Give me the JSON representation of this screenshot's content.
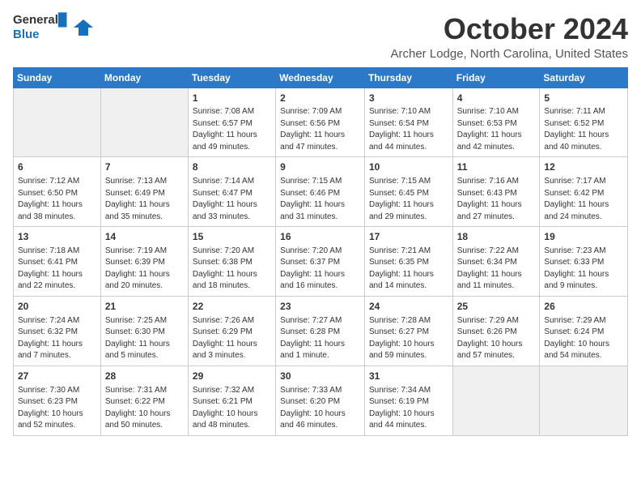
{
  "logo": {
    "line1": "General",
    "line2": "Blue"
  },
  "title": "October 2024",
  "location": "Archer Lodge, North Carolina, United States",
  "weekdays": [
    "Sunday",
    "Monday",
    "Tuesday",
    "Wednesday",
    "Thursday",
    "Friday",
    "Saturday"
  ],
  "weeks": [
    [
      {
        "day": "",
        "info": ""
      },
      {
        "day": "",
        "info": ""
      },
      {
        "day": "1",
        "info": "Sunrise: 7:08 AM\nSunset: 6:57 PM\nDaylight: 11 hours\nand 49 minutes."
      },
      {
        "day": "2",
        "info": "Sunrise: 7:09 AM\nSunset: 6:56 PM\nDaylight: 11 hours\nand 47 minutes."
      },
      {
        "day": "3",
        "info": "Sunrise: 7:10 AM\nSunset: 6:54 PM\nDaylight: 11 hours\nand 44 minutes."
      },
      {
        "day": "4",
        "info": "Sunrise: 7:10 AM\nSunset: 6:53 PM\nDaylight: 11 hours\nand 42 minutes."
      },
      {
        "day": "5",
        "info": "Sunrise: 7:11 AM\nSunset: 6:52 PM\nDaylight: 11 hours\nand 40 minutes."
      }
    ],
    [
      {
        "day": "6",
        "info": "Sunrise: 7:12 AM\nSunset: 6:50 PM\nDaylight: 11 hours\nand 38 minutes."
      },
      {
        "day": "7",
        "info": "Sunrise: 7:13 AM\nSunset: 6:49 PM\nDaylight: 11 hours\nand 35 minutes."
      },
      {
        "day": "8",
        "info": "Sunrise: 7:14 AM\nSunset: 6:47 PM\nDaylight: 11 hours\nand 33 minutes."
      },
      {
        "day": "9",
        "info": "Sunrise: 7:15 AM\nSunset: 6:46 PM\nDaylight: 11 hours\nand 31 minutes."
      },
      {
        "day": "10",
        "info": "Sunrise: 7:15 AM\nSunset: 6:45 PM\nDaylight: 11 hours\nand 29 minutes."
      },
      {
        "day": "11",
        "info": "Sunrise: 7:16 AM\nSunset: 6:43 PM\nDaylight: 11 hours\nand 27 minutes."
      },
      {
        "day": "12",
        "info": "Sunrise: 7:17 AM\nSunset: 6:42 PM\nDaylight: 11 hours\nand 24 minutes."
      }
    ],
    [
      {
        "day": "13",
        "info": "Sunrise: 7:18 AM\nSunset: 6:41 PM\nDaylight: 11 hours\nand 22 minutes."
      },
      {
        "day": "14",
        "info": "Sunrise: 7:19 AM\nSunset: 6:39 PM\nDaylight: 11 hours\nand 20 minutes."
      },
      {
        "day": "15",
        "info": "Sunrise: 7:20 AM\nSunset: 6:38 PM\nDaylight: 11 hours\nand 18 minutes."
      },
      {
        "day": "16",
        "info": "Sunrise: 7:20 AM\nSunset: 6:37 PM\nDaylight: 11 hours\nand 16 minutes."
      },
      {
        "day": "17",
        "info": "Sunrise: 7:21 AM\nSunset: 6:35 PM\nDaylight: 11 hours\nand 14 minutes."
      },
      {
        "day": "18",
        "info": "Sunrise: 7:22 AM\nSunset: 6:34 PM\nDaylight: 11 hours\nand 11 minutes."
      },
      {
        "day": "19",
        "info": "Sunrise: 7:23 AM\nSunset: 6:33 PM\nDaylight: 11 hours\nand 9 minutes."
      }
    ],
    [
      {
        "day": "20",
        "info": "Sunrise: 7:24 AM\nSunset: 6:32 PM\nDaylight: 11 hours\nand 7 minutes."
      },
      {
        "day": "21",
        "info": "Sunrise: 7:25 AM\nSunset: 6:30 PM\nDaylight: 11 hours\nand 5 minutes."
      },
      {
        "day": "22",
        "info": "Sunrise: 7:26 AM\nSunset: 6:29 PM\nDaylight: 11 hours\nand 3 minutes."
      },
      {
        "day": "23",
        "info": "Sunrise: 7:27 AM\nSunset: 6:28 PM\nDaylight: 11 hours\nand 1 minute."
      },
      {
        "day": "24",
        "info": "Sunrise: 7:28 AM\nSunset: 6:27 PM\nDaylight: 10 hours\nand 59 minutes."
      },
      {
        "day": "25",
        "info": "Sunrise: 7:29 AM\nSunset: 6:26 PM\nDaylight: 10 hours\nand 57 minutes."
      },
      {
        "day": "26",
        "info": "Sunrise: 7:29 AM\nSunset: 6:24 PM\nDaylight: 10 hours\nand 54 minutes."
      }
    ],
    [
      {
        "day": "27",
        "info": "Sunrise: 7:30 AM\nSunset: 6:23 PM\nDaylight: 10 hours\nand 52 minutes."
      },
      {
        "day": "28",
        "info": "Sunrise: 7:31 AM\nSunset: 6:22 PM\nDaylight: 10 hours\nand 50 minutes."
      },
      {
        "day": "29",
        "info": "Sunrise: 7:32 AM\nSunset: 6:21 PM\nDaylight: 10 hours\nand 48 minutes."
      },
      {
        "day": "30",
        "info": "Sunrise: 7:33 AM\nSunset: 6:20 PM\nDaylight: 10 hours\nand 46 minutes."
      },
      {
        "day": "31",
        "info": "Sunrise: 7:34 AM\nSunset: 6:19 PM\nDaylight: 10 hours\nand 44 minutes."
      },
      {
        "day": "",
        "info": ""
      },
      {
        "day": "",
        "info": ""
      }
    ]
  ]
}
